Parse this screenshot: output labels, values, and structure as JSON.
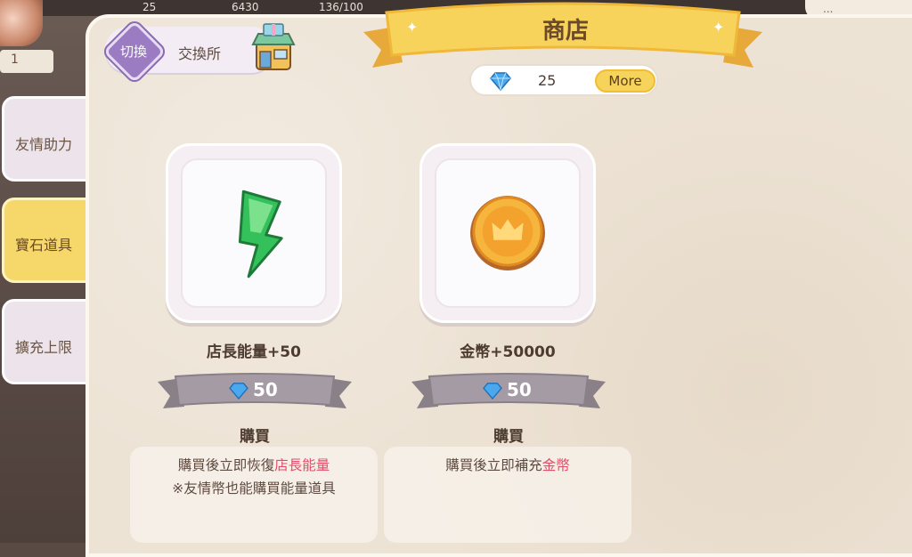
{
  "hud": {
    "gems": "25",
    "coins": "6430",
    "energy": "136/100",
    "level": "1",
    "right_label": "..."
  },
  "switch": {
    "button_label": "切換",
    "target_label": "交換所"
  },
  "title": "商店",
  "currency": {
    "gems": "25",
    "more_label": "More"
  },
  "tabs": [
    {
      "label": "友情助力",
      "active": false
    },
    {
      "label": "寶石道具",
      "active": true
    },
    {
      "label": "擴充上限",
      "active": false
    }
  ],
  "items": [
    {
      "name": "店長能量+50",
      "price": "50",
      "buy_label": "購買",
      "desc_line1_pre": "購買後立即恢復",
      "desc_line1_hl": "店長能量",
      "desc_line2": "※友情幣也能購買能量道具",
      "icon": "green-energy-bolt-icon"
    },
    {
      "name": "金幣+50000",
      "price": "50",
      "buy_label": "購買",
      "desc_line1_pre": "購買後立即補充",
      "desc_line1_hl": "金幣",
      "icon": "gold-coin-crown-icon"
    }
  ],
  "colors": {
    "accent_yellow": "#f6d35a",
    "highlight_pink": "#e24d6a",
    "switch_purple": "#9b7bc2",
    "panel_bg": "#ede3d5"
  }
}
